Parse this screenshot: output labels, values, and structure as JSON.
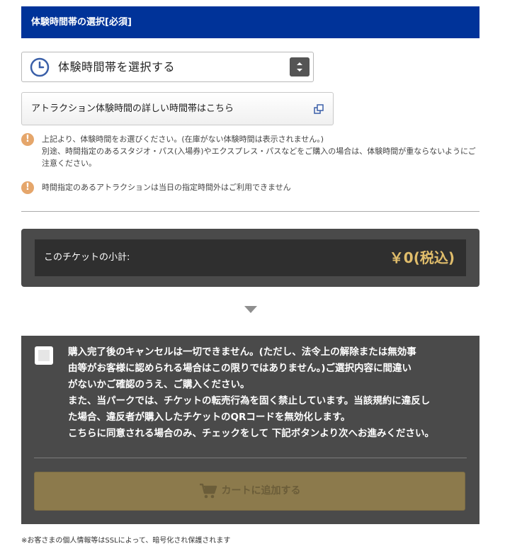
{
  "section": {
    "title": "体験時間帯の選択[必須]"
  },
  "time_select": {
    "label": "体験時間帯を選択する"
  },
  "detail_link": {
    "label": "アトラクション体験時間の詳しい時間帯はこちら"
  },
  "notices": [
    {
      "lines": [
        "上記より、体験時間をお選びください。(在庫がない体験時間は表示されません。)",
        "別途、時間指定のあるスタジオ・パス(入場券)やエクスプレス・パスなどをご購入の場合は、体験時間が重ならないようにご",
        "注意ください。"
      ]
    },
    {
      "lines": [
        "時間指定のあるアトラクションは当日の指定時間外はご利用できません"
      ]
    }
  ],
  "subtotal": {
    "label": "このチケットの小計:",
    "price": "￥0(税込)"
  },
  "consent": {
    "checked": false,
    "lines": [
      "購入完了後のキャンセルは一切できません。(ただし、法令上の解除または無効事",
      "由等がお客様に認められる場合はこの限りではありません。)ご選択内容に間違い",
      "がないかご確認のうえ、ご購入ください。",
      "また、当パークでは、チケットの転売行為を固く禁止しています。当該規約に違反し",
      "た場合、違反者が購入したチケットのQRコードを無効化します。",
      "こちらに同意される場合のみ、チェックをして 下記ボタンより次へお進みください。"
    ]
  },
  "cart_button": {
    "label": "カートに追加する",
    "icon": "cart-icon"
  },
  "footer": {
    "note": "※お客さまの個人情報等はSSLによって、暗号化され保護されます"
  },
  "colors": {
    "header_bg": "#003399",
    "price": "#e0bd6b",
    "panel_bg": "#4a4a4a",
    "warn": "#e5a66b",
    "button_bg": "#8c7a4c"
  }
}
